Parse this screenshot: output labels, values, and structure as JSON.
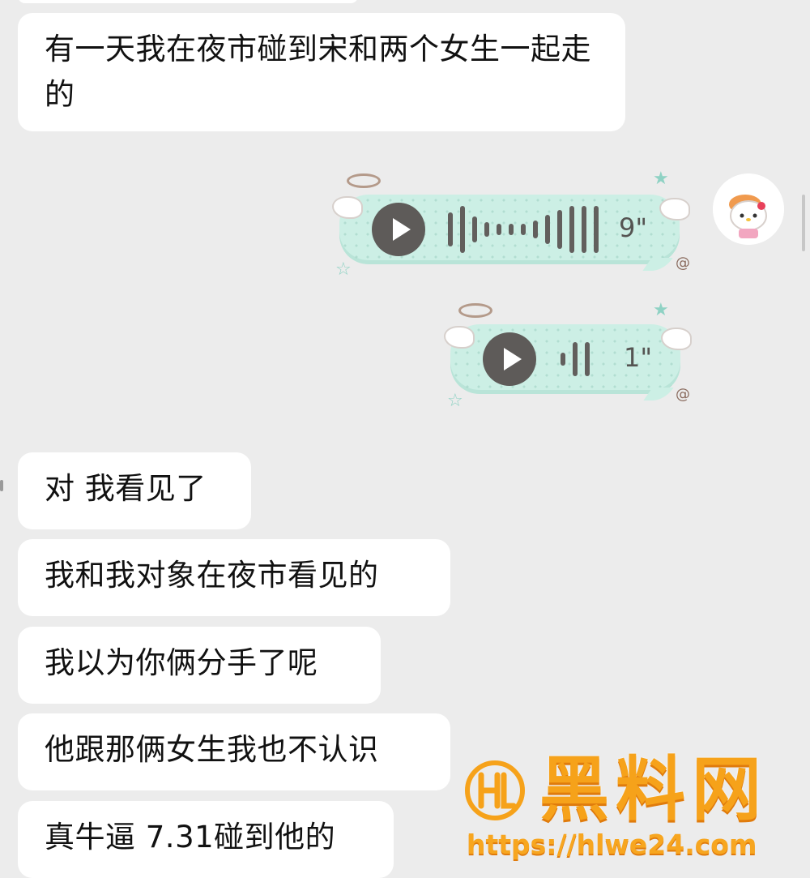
{
  "messages": [
    {
      "text": "有一天我在夜市碰到宋和两个女生一起走的"
    },
    {
      "text": "对 我看见了"
    },
    {
      "text": "我和我对象在夜市看见的"
    },
    {
      "text": "我以为你俩分手了呢"
    },
    {
      "text": "他跟那俩女生我也不认识"
    },
    {
      "text": "真牛逼  7.31碰到他的"
    }
  ],
  "voice_messages": [
    {
      "duration": "9\""
    },
    {
      "duration": "1\""
    }
  ],
  "watermark": {
    "title": "黑料网",
    "url": "https://hlwe24.com"
  },
  "colors": {
    "background": "#ececec",
    "bubble": "#ffffff",
    "voice_bubble": "#ccefe5",
    "watermark": "#f6a21a"
  }
}
